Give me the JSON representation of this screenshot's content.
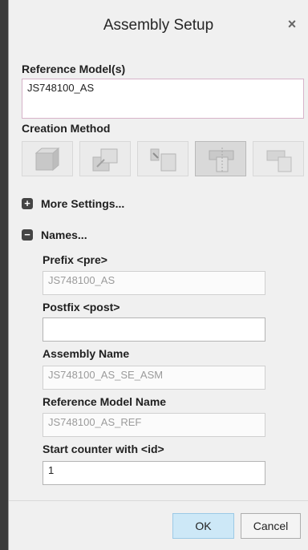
{
  "dialog": {
    "title": "Assembly Setup",
    "close_glyph": "×"
  },
  "reference_models": {
    "label": "Reference Model(s)",
    "value": "JS748100_AS"
  },
  "creation_method": {
    "label": "Creation Method",
    "buttons": [
      {
        "icon": "cube-icon",
        "active": false
      },
      {
        "icon": "default-placement-icon",
        "active": false
      },
      {
        "icon": "align-placement-icon",
        "active": false
      },
      {
        "icon": "origin-placement-icon",
        "active": true
      },
      {
        "icon": "ground-placement-icon",
        "active": false
      }
    ]
  },
  "more_settings": {
    "label": "More Settings...",
    "glyph": "+"
  },
  "names": {
    "label": "Names...",
    "glyph": "−",
    "prefix_label": "Prefix <pre>",
    "prefix_value": "JS748100_AS",
    "postfix_label": "Postfix <post>",
    "postfix_value": "",
    "assembly_name_label": "Assembly Name",
    "assembly_name_value": "JS748100_AS_SE_ASM",
    "reference_model_name_label": "Reference Model Name",
    "reference_model_name_value": "JS748100_AS_REF",
    "start_counter_label": "Start counter  with <id>",
    "start_counter_value": "1"
  },
  "footer": {
    "ok_label": "OK",
    "cancel_label": "Cancel"
  },
  "colors": {
    "ok_button": "#cde8f7",
    "dialog_bg": "#f0f0f0",
    "outer_bg": "#3a3a3a"
  }
}
